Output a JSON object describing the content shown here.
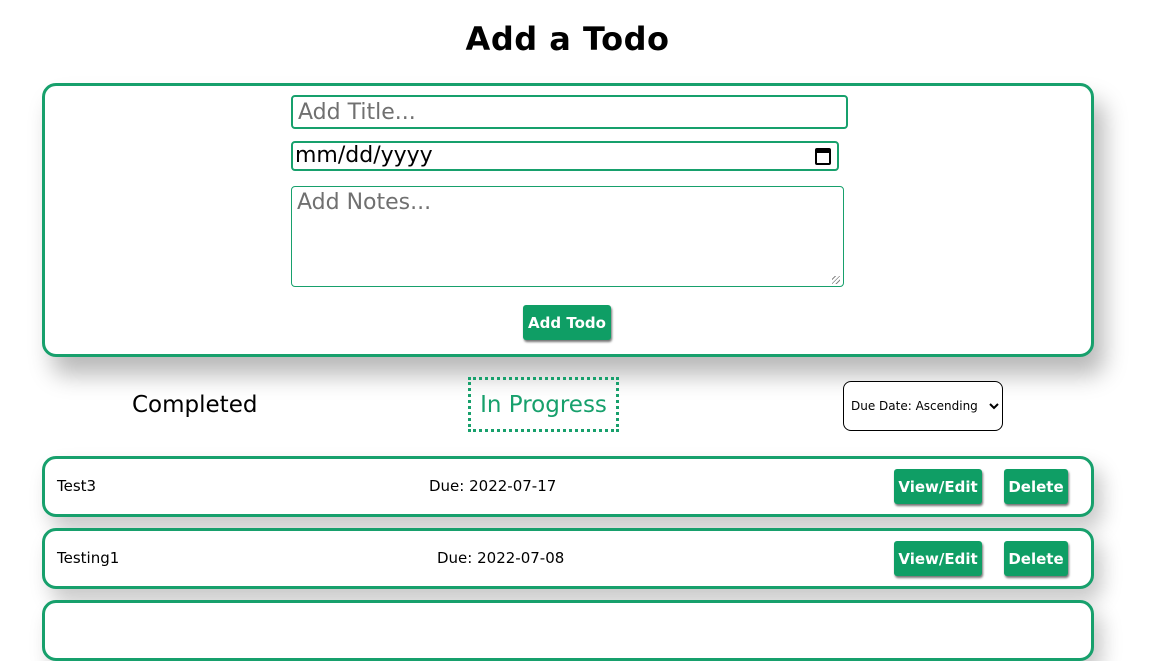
{
  "page_title": "Add a Todo",
  "form": {
    "title_placeholder": "Add Title...",
    "date_value": "mm/dd/yyyy",
    "notes_placeholder": "Add Notes...",
    "add_button": "Add Todo"
  },
  "filters": {
    "completed": "Completed",
    "in_progress": "In Progress",
    "active": "In Progress"
  },
  "sort": {
    "selected": "Due Date: Ascending"
  },
  "todos": [
    {
      "title": "Test3",
      "due": "Due: 2022-07-17",
      "view_label": "View/Edit",
      "delete_label": "Delete"
    },
    {
      "title": "Testing1",
      "due": "Due: 2022-07-08",
      "view_label": "View/Edit",
      "delete_label": "Delete"
    }
  ],
  "colors": {
    "accent": "#17a06c",
    "button": "#0f9e65"
  },
  "icons": {
    "date_picker": "calendar-icon",
    "sort_dropdown": "chevron-down-icon"
  }
}
